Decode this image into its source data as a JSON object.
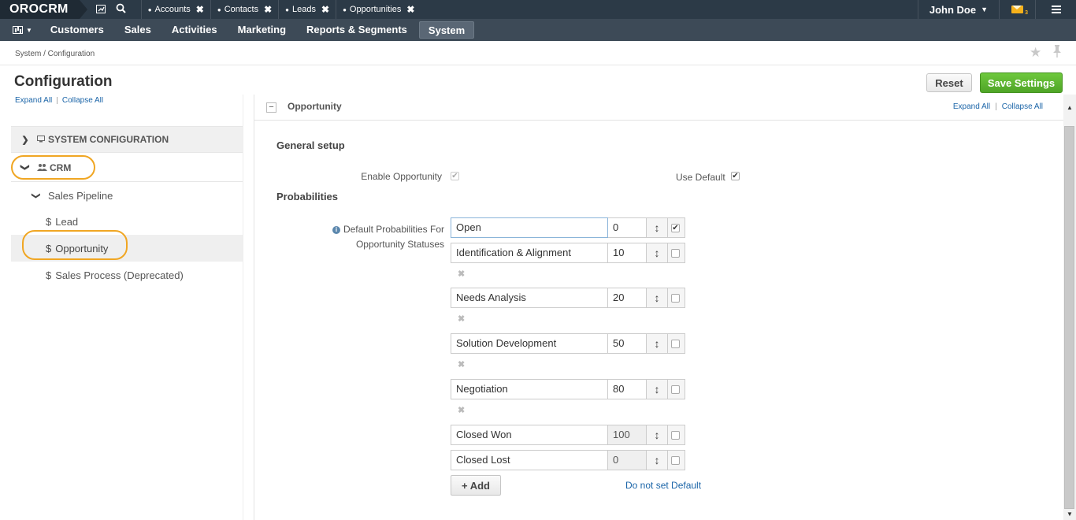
{
  "topbar": {
    "logo": "OROCRM",
    "pinned_tabs": [
      {
        "label": "Accounts"
      },
      {
        "label": "Contacts"
      },
      {
        "label": "Leads"
      },
      {
        "label": "Opportunities"
      }
    ],
    "user_name": "John Doe",
    "mail_count": "3"
  },
  "menu": {
    "items": [
      "Customers",
      "Sales",
      "Activities",
      "Marketing",
      "Reports & Segments",
      "System"
    ],
    "active": "System"
  },
  "breadcrumb": "System / Configuration",
  "page": {
    "title": "Configuration",
    "reset_label": "Reset",
    "save_label": "Save Settings"
  },
  "sidebar": {
    "expand_all": "Expand All",
    "collapse_all": "Collapse All",
    "system_configuration": "SYSTEM CONFIGURATION",
    "crm": "CRM",
    "sales_pipeline": "Sales Pipeline",
    "lead": "Lead",
    "opportunity": "Opportunity",
    "sales_process": "Sales Process (Deprecated)"
  },
  "section": {
    "title": "Opportunity",
    "expand_all": "Expand All",
    "collapse_all": "Collapse All",
    "general_setup": "General setup",
    "enable_opportunity_label": "Enable Opportunity",
    "use_default_label": "Use Default",
    "probabilities": "Probabilities",
    "default_prob_label_1": "Default Probabilities For",
    "default_prob_label_2": "Opportunity Statuses",
    "add_label": "+ Add",
    "do_not_set_default": "Do not set Default"
  },
  "probabilities": [
    {
      "name": "Open",
      "value": "0",
      "default": true,
      "removable": false,
      "readonly": false
    },
    {
      "name": "Identification & Alignment",
      "value": "10",
      "default": false,
      "removable": true,
      "readonly": false
    },
    {
      "name": "Needs Analysis",
      "value": "20",
      "default": false,
      "removable": true,
      "readonly": false
    },
    {
      "name": "Solution Development",
      "value": "50",
      "default": false,
      "removable": true,
      "readonly": false
    },
    {
      "name": "Negotiation",
      "value": "80",
      "default": false,
      "removable": true,
      "readonly": false
    },
    {
      "name": "Closed Won",
      "value": "100",
      "default": false,
      "removable": false,
      "readonly": true
    },
    {
      "name": "Closed Lost",
      "value": "0",
      "default": false,
      "removable": false,
      "readonly": true
    }
  ],
  "colors": {
    "topbar": "#2c3a47",
    "menubar": "#3d4a57",
    "save_button": "#5cb630",
    "link": "#1b65a8",
    "highlight": "#f0a623"
  }
}
